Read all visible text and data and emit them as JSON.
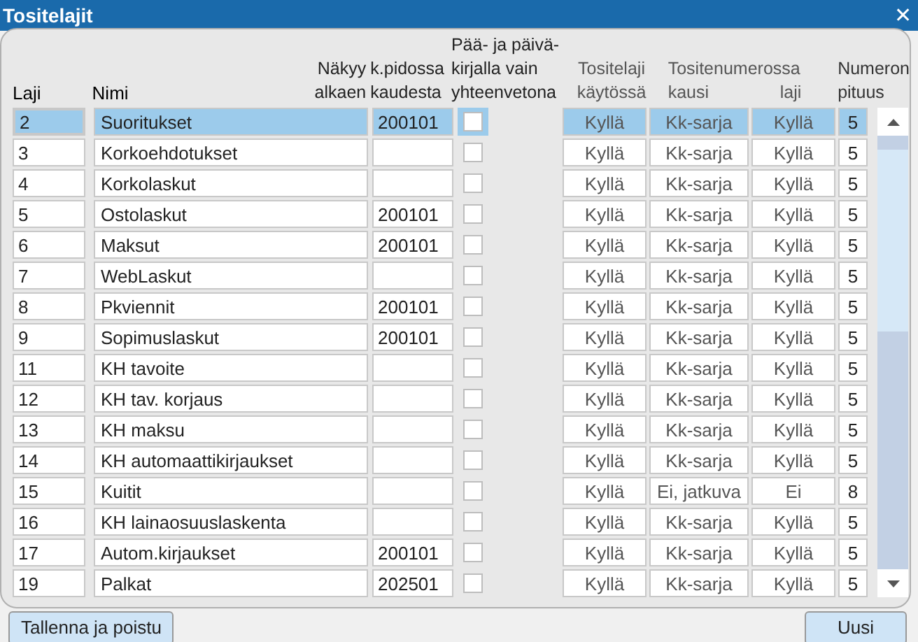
{
  "window": {
    "title": "Tositelajit",
    "close": "✕"
  },
  "columns": {
    "laji": "Laji",
    "nimi": "Nimi",
    "nakyy_1": "Näkyy",
    "nakyy_2": "alkaen",
    "kp_1": "k.pidossa",
    "kp_2": "kaudesta",
    "paa": [
      "Pää- ja päivä-",
      "kirjalla vain",
      "yhteenvetona"
    ],
    "tositelaji": [
      "Tositelaji",
      "käytössä"
    ],
    "tositenumerossa": "Tositenumerossa",
    "kausi": "kausi",
    "tn_laji": "laji",
    "numeron": [
      "Numeron",
      "pituus"
    ]
  },
  "rows": [
    {
      "laji": "2",
      "nimi": "Suoritukset",
      "kausi_alku": "200101",
      "checked": false,
      "kaytossa": "Kyllä",
      "kausi": "Kk-sarja",
      "tn_laji": "Kyllä",
      "pituus": "5",
      "selected": true
    },
    {
      "laji": "3",
      "nimi": "Korkoehdotukset",
      "kausi_alku": "",
      "checked": false,
      "kaytossa": "Kyllä",
      "kausi": "Kk-sarja",
      "tn_laji": "Kyllä",
      "pituus": "5",
      "selected": false
    },
    {
      "laji": "4",
      "nimi": "Korkolaskut",
      "kausi_alku": "",
      "checked": false,
      "kaytossa": "Kyllä",
      "kausi": "Kk-sarja",
      "tn_laji": "Kyllä",
      "pituus": "5",
      "selected": false
    },
    {
      "laji": "5",
      "nimi": "Ostolaskut",
      "kausi_alku": "200101",
      "checked": false,
      "kaytossa": "Kyllä",
      "kausi": "Kk-sarja",
      "tn_laji": "Kyllä",
      "pituus": "5",
      "selected": false
    },
    {
      "laji": "6",
      "nimi": "Maksut",
      "kausi_alku": "200101",
      "checked": false,
      "kaytossa": "Kyllä",
      "kausi": "Kk-sarja",
      "tn_laji": "Kyllä",
      "pituus": "5",
      "selected": false
    },
    {
      "laji": "7",
      "nimi": "WebLaskut",
      "kausi_alku": "",
      "checked": false,
      "kaytossa": "Kyllä",
      "kausi": "Kk-sarja",
      "tn_laji": "Kyllä",
      "pituus": "5",
      "selected": false
    },
    {
      "laji": "8",
      "nimi": "Pkviennit",
      "kausi_alku": "200101",
      "checked": false,
      "kaytossa": "Kyllä",
      "kausi": "Kk-sarja",
      "tn_laji": "Kyllä",
      "pituus": "5",
      "selected": false
    },
    {
      "laji": "9",
      "nimi": "Sopimuslaskut",
      "kausi_alku": "200101",
      "checked": false,
      "kaytossa": "Kyllä",
      "kausi": "Kk-sarja",
      "tn_laji": "Kyllä",
      "pituus": "5",
      "selected": false
    },
    {
      "laji": "11",
      "nimi": "KH tavoite",
      "kausi_alku": "",
      "checked": false,
      "kaytossa": "Kyllä",
      "kausi": "Kk-sarja",
      "tn_laji": "Kyllä",
      "pituus": "5",
      "selected": false
    },
    {
      "laji": "12",
      "nimi": "KH tav. korjaus",
      "kausi_alku": "",
      "checked": false,
      "kaytossa": "Kyllä",
      "kausi": "Kk-sarja",
      "tn_laji": "Kyllä",
      "pituus": "5",
      "selected": false
    },
    {
      "laji": "13",
      "nimi": "KH maksu",
      "kausi_alku": "",
      "checked": false,
      "kaytossa": "Kyllä",
      "kausi": "Kk-sarja",
      "tn_laji": "Kyllä",
      "pituus": "5",
      "selected": false
    },
    {
      "laji": "14",
      "nimi": "KH automaattikirjaukset",
      "kausi_alku": "",
      "checked": false,
      "kaytossa": "Kyllä",
      "kausi": "Kk-sarja",
      "tn_laji": "Kyllä",
      "pituus": "5",
      "selected": false
    },
    {
      "laji": "15",
      "nimi": "Kuitit",
      "kausi_alku": "",
      "checked": false,
      "kaytossa": "Kyllä",
      "kausi": "Ei, jatkuva",
      "tn_laji": "Ei",
      "pituus": "8",
      "selected": false
    },
    {
      "laji": "16",
      "nimi": "KH lainaosuuslaskenta",
      "kausi_alku": "",
      "checked": false,
      "kaytossa": "Kyllä",
      "kausi": "Kk-sarja",
      "tn_laji": "Kyllä",
      "pituus": "5",
      "selected": false
    },
    {
      "laji": "17",
      "nimi": "Autom.kirjaukset",
      "kausi_alku": "200101",
      "checked": false,
      "kaytossa": "Kyllä",
      "kausi": "Kk-sarja",
      "tn_laji": "Kyllä",
      "pituus": "5",
      "selected": false
    },
    {
      "laji": "19",
      "nimi": "Palkat",
      "kausi_alku": "202501",
      "checked": false,
      "kaytossa": "Kyllä",
      "kausi": "Kk-sarja",
      "tn_laji": "Kyllä",
      "pituus": "5",
      "selected": false
    }
  ],
  "buttons": {
    "save": "Tallenna ja poistu",
    "new": "Uusi"
  }
}
